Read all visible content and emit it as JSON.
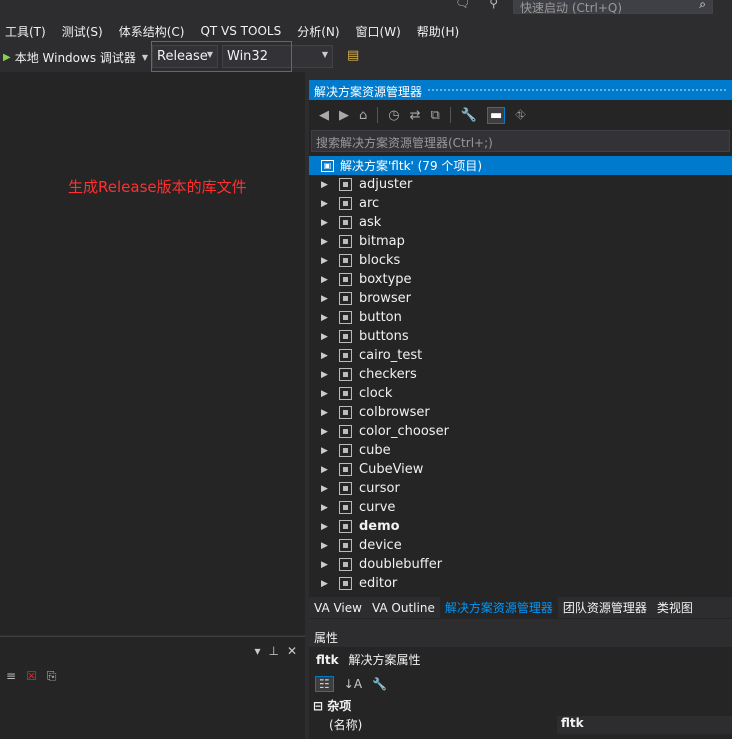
{
  "quicklaunch": {
    "placeholder": "快速启动 (Ctrl+Q)"
  },
  "menu": [
    "工具(T)",
    "测试(S)",
    "体系结构(C)",
    "QT VS TOOLS",
    "分析(N)",
    "窗口(W)",
    "帮助(H)"
  ],
  "toolbar": {
    "debugger_label": "本地 Windows 调试器",
    "config": "Release",
    "platform": "Win32"
  },
  "editor": {
    "note": "生成Release版本的库文件"
  },
  "solution_explorer": {
    "title": "解决方案资源管理器",
    "search_placeholder": "搜索解决方案资源管理器(Ctrl+;)",
    "root": "解决方案'fltk' (79 个项目)",
    "items": [
      {
        "label": "adjuster",
        "bold": false
      },
      {
        "label": "arc",
        "bold": false
      },
      {
        "label": "ask",
        "bold": false
      },
      {
        "label": "bitmap",
        "bold": false
      },
      {
        "label": "blocks",
        "bold": false
      },
      {
        "label": "boxtype",
        "bold": false
      },
      {
        "label": "browser",
        "bold": false
      },
      {
        "label": "button",
        "bold": false
      },
      {
        "label": "buttons",
        "bold": false
      },
      {
        "label": "cairo_test",
        "bold": false
      },
      {
        "label": "checkers",
        "bold": false
      },
      {
        "label": "clock",
        "bold": false
      },
      {
        "label": "colbrowser",
        "bold": false
      },
      {
        "label": "color_chooser",
        "bold": false
      },
      {
        "label": "cube",
        "bold": false
      },
      {
        "label": "CubeView",
        "bold": false
      },
      {
        "label": "cursor",
        "bold": false
      },
      {
        "label": "curve",
        "bold": false
      },
      {
        "label": "demo",
        "bold": true
      },
      {
        "label": "device",
        "bold": false
      },
      {
        "label": "doublebuffer",
        "bold": false
      },
      {
        "label": "editor",
        "bold": false
      }
    ]
  },
  "tabs": [
    "VA View",
    "VA Outline",
    "解决方案资源管理器",
    "团队资源管理器",
    "类视图"
  ],
  "active_tab_index": 2,
  "properties": {
    "title": "属性",
    "object_name": "fltk",
    "object_type": "解决方案属性",
    "category": "杂项",
    "row_key": "(名称)",
    "row_value": "fltk"
  },
  "colors": {
    "accent": "#007acc",
    "note_red": "#ff3030",
    "highlight_box": "#e8302c"
  }
}
